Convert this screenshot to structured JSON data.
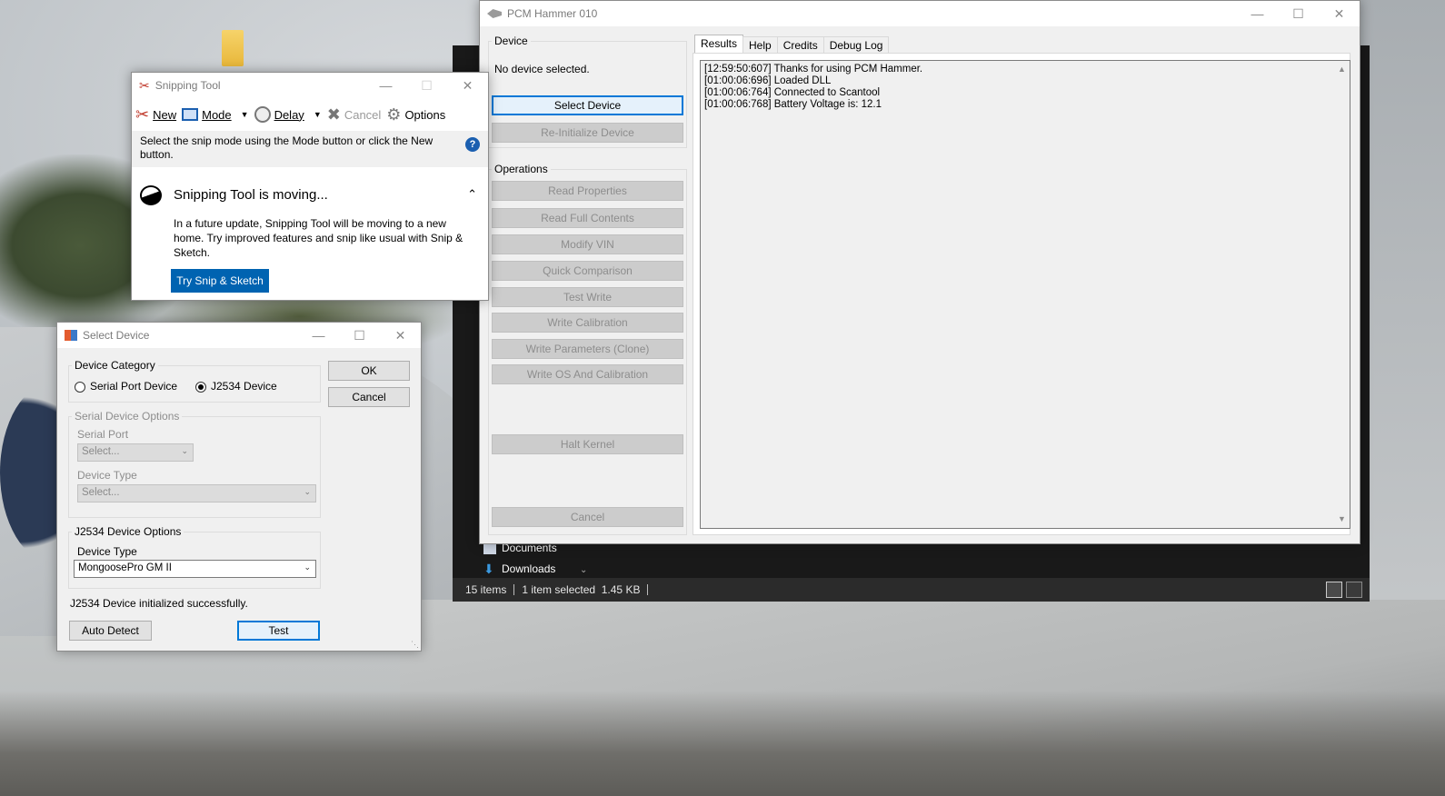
{
  "explorer": {
    "nav_items": [
      {
        "label": "Documents"
      },
      {
        "label": "Downloads"
      }
    ],
    "status": {
      "items_count": "15 items",
      "selection": "1 item selected",
      "size": "1.45 KB"
    }
  },
  "pcm_hammer": {
    "title": "PCM Hammer 010",
    "device_group": {
      "label": "Device",
      "status": "No device selected.",
      "select_device": "Select Device",
      "reinitialize": "Re-Initialize Device"
    },
    "operations_group": {
      "label": "Operations",
      "buttons": [
        "Read Properties",
        "Read Full Contents",
        "Modify VIN",
        "Quick Comparison",
        "Test Write",
        "Write Calibration",
        "Write Parameters (Clone)",
        "Write OS And Calibration"
      ],
      "halt_kernel": "Halt Kernel",
      "cancel": "Cancel"
    },
    "tabs": [
      {
        "label": "Results",
        "active": true
      },
      {
        "label": "Help"
      },
      {
        "label": "Credits"
      },
      {
        "label": "Debug Log"
      }
    ],
    "log_lines": [
      "[12:59:50:607]  Thanks for using PCM Hammer.",
      "[01:00:06:696]  Loaded DLL",
      "[01:00:06:764]  Connected to Scantool",
      "[01:00:06:768]  Battery Voltage is: 12.1"
    ]
  },
  "snipping_tool": {
    "title": "Snipping Tool",
    "toolbar": {
      "new": "New",
      "mode": "Mode",
      "delay": "Delay",
      "cancel": "Cancel",
      "options": "Options"
    },
    "info_text": "Select the snip mode using the Mode button or click the New button.",
    "notice_title": "Snipping Tool is moving...",
    "notice_body": "In a future update, Snipping Tool will be moving to a new home. Try improved features and snip like usual with Snip & Sketch.",
    "try_button": "Try Snip & Sketch"
  },
  "select_device": {
    "title": "Select Device",
    "category": {
      "label": "Device Category",
      "serial": "Serial Port Device",
      "j2534": "J2534 Device",
      "selected": "j2534"
    },
    "ok": "OK",
    "cancel": "Cancel",
    "serial_options": {
      "label": "Serial Device Options",
      "port_label": "Serial Port",
      "port_value": "Select...",
      "type_label": "Device Type",
      "type_value": "Select..."
    },
    "j2534_options": {
      "label": "J2534 Device Options",
      "type_label": "Device Type",
      "type_value": "MongoosePro GM II"
    },
    "status": "J2534 Device initialized successfully.",
    "auto_detect": "Auto Detect",
    "test": "Test"
  }
}
